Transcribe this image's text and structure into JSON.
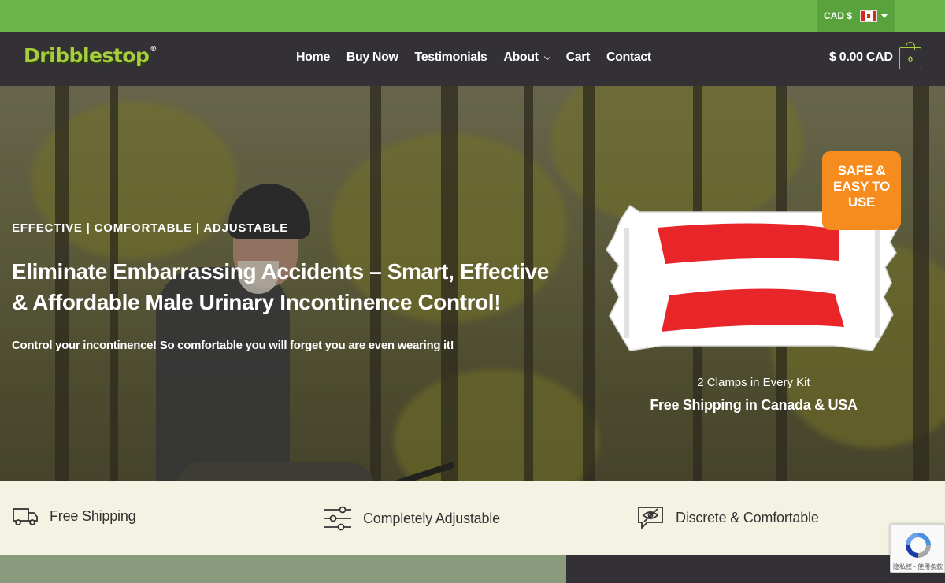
{
  "topbar": {
    "currency_label": "CAD $",
    "flag_icon": "canada-flag-icon"
  },
  "header": {
    "logo_text": "Dribblestop",
    "logo_mark": "®",
    "nav": {
      "home": "Home",
      "buy_now": "Buy Now",
      "testimonials": "Testimonials",
      "about": "About",
      "cart": "Cart",
      "contact": "Contact"
    },
    "cart_total": "$ 0.00 CAD",
    "cart_count": "0"
  },
  "hero": {
    "tagline": "EFFECTIVE | COMFORTABLE | ADJUSTABLE",
    "title": "Eliminate Embarrassing Accidents – Smart, Effective & Affordable Male Urinary Incontinence Control!",
    "subtitle": "Control your incontinence! So comfortable you will forget you are even wearing it!",
    "badge_lines": [
      "SAFE &",
      "EASY TO",
      "USE"
    ],
    "kit_text": "2 Clamps in Every Kit",
    "shipping_text": "Free Shipping in Canada & USA"
  },
  "features": [
    {
      "icon": "truck-icon",
      "label": "Free Shipping"
    },
    {
      "icon": "sliders-icon",
      "label": "Completely Adjustable"
    },
    {
      "icon": "eye-off-icon",
      "label": "Discrete & Comfortable"
    }
  ],
  "recaptcha": {
    "text": "隐私权 - 使用条款"
  },
  "colors": {
    "topbar": "#6ab64a",
    "header": "#333135",
    "logo": "#a6cd3c",
    "badge": "#f68b1e",
    "features_bg": "#f4f3e3",
    "product_pad": "#e8262a"
  }
}
